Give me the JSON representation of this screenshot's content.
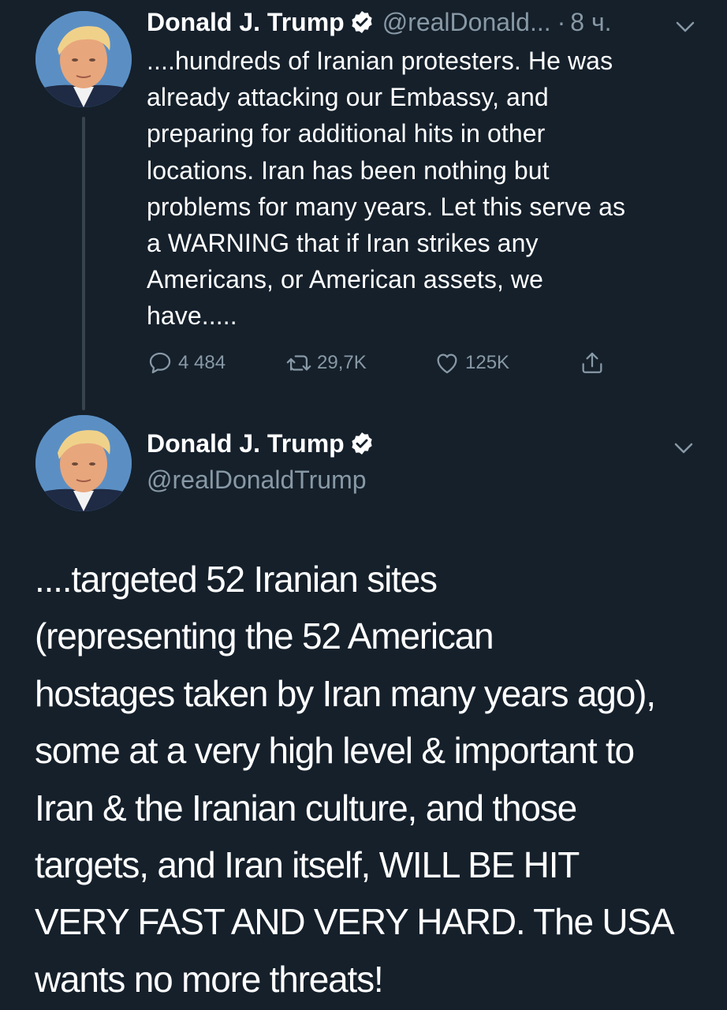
{
  "colors": {
    "background": "#15202b",
    "text": "#ffffff",
    "muted": "#8899a6",
    "thread_line": "#38444d",
    "verified_badge": "#ffffff"
  },
  "tweet1": {
    "display_name": "Donald J. Trump",
    "handle": "@realDonald...",
    "separator": "·",
    "time": "8 ч.",
    "text": "....hundreds of Iranian protesters. He was\nalready attacking our Embassy, and\npreparing for additional hits in other\nlocations. Iran has been nothing but\nproblems for many years. Let this serve as\na WARNING that if Iran strikes any\nAmericans, or American assets, we\nhave.....",
    "actions": {
      "reply_count": "4 484",
      "retweet_count": "29,7K",
      "like_count": "125K"
    },
    "icons": [
      "avatar",
      "verified-badge-icon",
      "chevron-down-icon",
      "reply-icon",
      "retweet-icon",
      "like-icon",
      "share-icon"
    ]
  },
  "tweet2": {
    "display_name": "Donald J. Trump",
    "handle": "@realDonaldTrump",
    "text": "....targeted 52 Iranian sites\n(representing the 52 American\nhostages taken by Iran many years ago),\nsome at a very high level & important to\nIran &  the Iranian culture, and those\ntargets, and Iran itself, WILL BE HIT\nVERY FAST AND VERY HARD. The USA\nwants no more threats!",
    "icons": [
      "avatar",
      "verified-badge-icon",
      "chevron-down-icon"
    ]
  }
}
